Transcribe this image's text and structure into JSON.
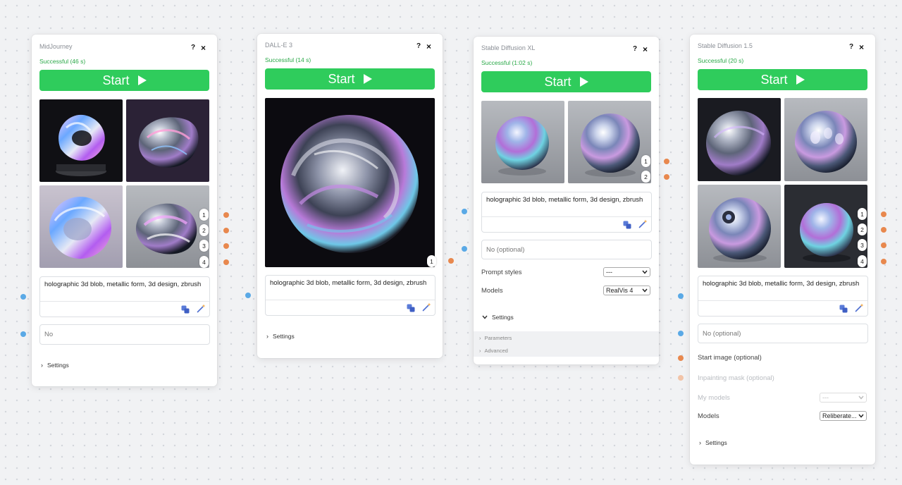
{
  "common": {
    "start_label": "Start",
    "help_label": "?",
    "close_label": "×",
    "prompt_text": "holographic 3d blob, metallic form, 3d design, zbrush",
    "settings_label": "Settings",
    "chevron_right": "›",
    "chevron_down": "⌄",
    "badge_1": "1",
    "badge_2": "2",
    "badge_3": "3",
    "badge_4": "4"
  },
  "panels": {
    "midjourney": {
      "title": "MidJourney",
      "status": "Successful (46 s)",
      "negative_value": "No"
    },
    "dalle3": {
      "title": "DALL-E 3",
      "status": "Successful (14 s)"
    },
    "sdxl": {
      "title": "Stable Diffusion XL",
      "status": "Successful (1:02 s)",
      "negative_placeholder": "No (optional)",
      "prompt_styles_label": "Prompt styles",
      "prompt_styles_value": "---",
      "models_label": "Models",
      "models_value": "RealVis 4",
      "parameters_label": "Parameters",
      "advanced_label": "Advanced"
    },
    "sd15": {
      "title": "Stable Diffusion 1.5",
      "status": "Successful (20 s)",
      "negative_placeholder": "No (optional)",
      "start_image_label": "Start image (optional)",
      "inpainting_label": "Inpainting mask (optional)",
      "my_models_label": "My models",
      "my_models_value": "---",
      "models_label": "Models",
      "models_value": "Reliberate..."
    }
  },
  "colors": {
    "success_green": "#29a847",
    "start_button": "#2fcc5c",
    "connector_blue": "#5aa9e6",
    "connector_orange": "#e8884e"
  }
}
